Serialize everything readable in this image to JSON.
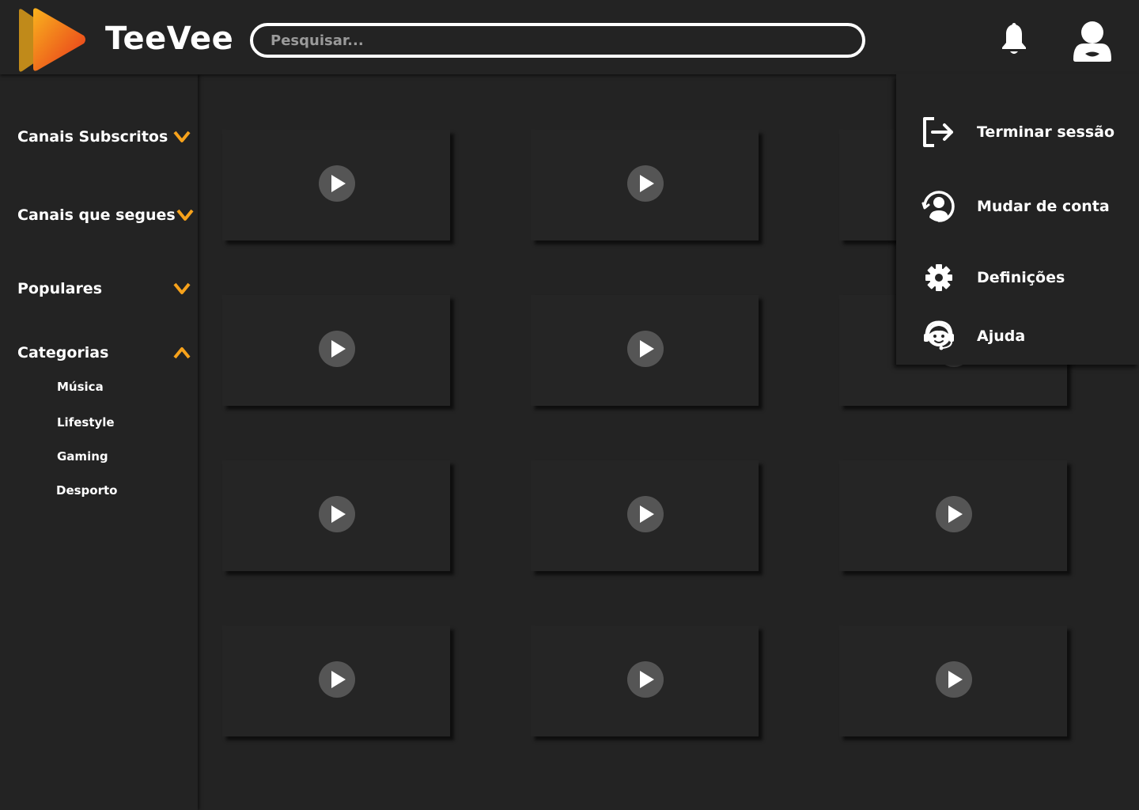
{
  "header": {
    "brand": "TeeVee",
    "search_placeholder": "Pesquisar...",
    "icons": {
      "logo": "play-logo-icon",
      "notifications": "bell-icon",
      "account": "user-icon"
    },
    "colors": {
      "logo_orange": "#F7A21B",
      "logo_red": "#E8341C",
      "accent": "#F7A21B"
    }
  },
  "sidebar": {
    "sections": [
      {
        "label": "Canais Subscritos",
        "state": "collapsed",
        "icon": "chevron-down-icon"
      },
      {
        "label": "Canais que segues",
        "state": "collapsed",
        "icon": "chevron-down-icon"
      },
      {
        "label": "Populares",
        "state": "collapsed",
        "icon": "chevron-down-icon"
      },
      {
        "label": "Categorias",
        "state": "expanded",
        "icon": "chevron-up-icon"
      }
    ],
    "categories": [
      "Música",
      "Lifestyle",
      "Gaming",
      "Desporto"
    ]
  },
  "account_menu": {
    "items": [
      {
        "label": "Terminar sessão",
        "icon": "logout-icon"
      },
      {
        "label": "Mudar de conta",
        "icon": "switch-account-icon"
      },
      {
        "label": "Definições",
        "icon": "gear-icon"
      },
      {
        "label": "Ajuda",
        "icon": "support-agent-icon"
      }
    ]
  },
  "videos": {
    "rows": 4,
    "columns": 3,
    "thumbnail_icon": "play-icon"
  }
}
